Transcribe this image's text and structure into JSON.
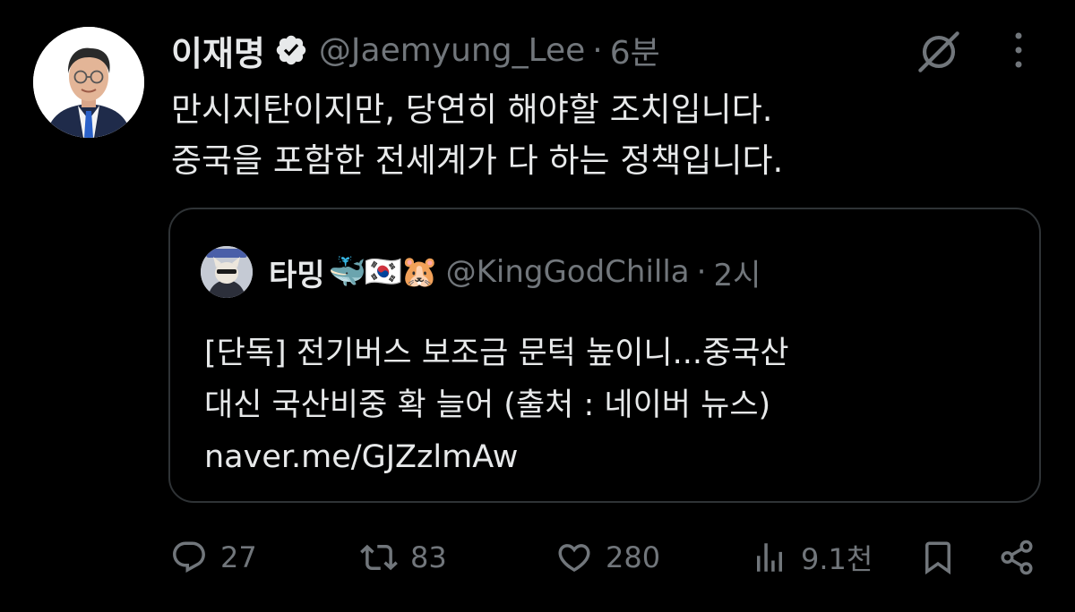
{
  "tweet": {
    "display_name": "이재명",
    "handle": "@Jaemyung_Lee",
    "separator": "·",
    "time": "6분",
    "text_lines": [
      "만시지탄이지만, 당연히 해야할 조치입니다.",
      "중국을 포함한 전세계가 다 하는 정책입니다."
    ]
  },
  "quote": {
    "display_name": "타밍",
    "emojis": "🐳🇰🇷🐹",
    "handle": "@KingGodChilla",
    "separator": "·",
    "time": "2시",
    "text_lines": [
      "[단독] 전기버스 보조금 문턱 높이니...중국산",
      "대신 국산비중 확 늘어 (출처 : 네이버 뉴스)",
      "naver.me/GJZzlmAw"
    ]
  },
  "actions": {
    "replies": "27",
    "reposts": "83",
    "likes": "280",
    "views": "9.1천"
  },
  "colors": {
    "background": "#000000",
    "text": "#e7e9ea",
    "secondary": "#71767b",
    "border": "#2f3336",
    "verified": "#e7e9ea"
  },
  "icons": [
    "verified-badge-icon",
    "grok-icon",
    "more-icon",
    "reply-icon",
    "repost-icon",
    "like-icon",
    "views-icon",
    "bookmark-icon",
    "share-icon"
  ]
}
